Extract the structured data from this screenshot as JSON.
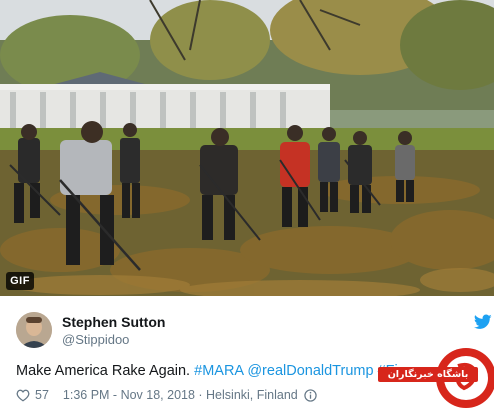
{
  "media": {
    "gif_label": "GIF"
  },
  "author": {
    "name": "Stephen Sutton",
    "handle": "@Stippidoo"
  },
  "tweet": {
    "text_plain": "Make America Rake Again. ",
    "tag1": "#MARA",
    "tag2": "@realDonaldTrump",
    "tag3": "#Fin"
  },
  "footer": {
    "likes": "57",
    "datetime": "1:36 PM - Nov 18, 2018 · Helsinki, Finland"
  },
  "overlay": {
    "site_name": "باشگاه خبرنگاران"
  },
  "colors": {
    "link": "#1b95e0",
    "muted": "#657786",
    "twitter_blue": "#1da1f2",
    "brand_red": "#d7261b"
  }
}
